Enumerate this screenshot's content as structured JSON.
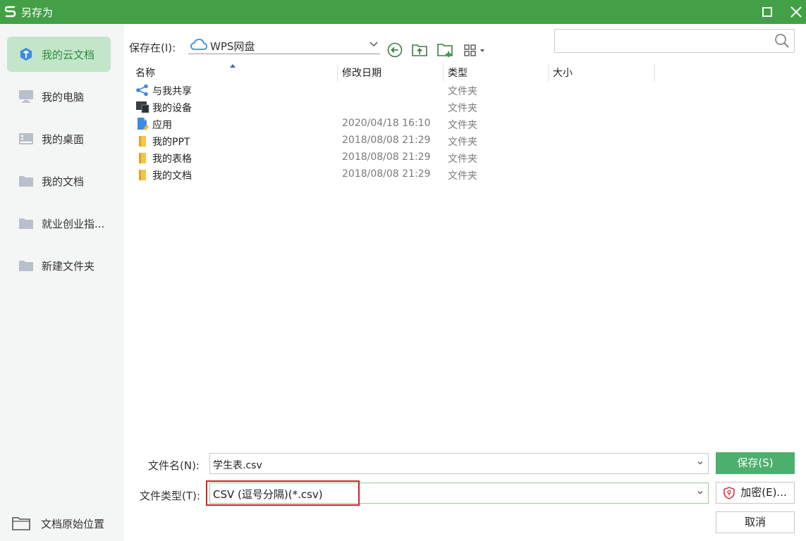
{
  "window": {
    "title": "另存为"
  },
  "sidebar": {
    "items": [
      {
        "label": "我的云文档",
        "icon": "cloud-docs-icon",
        "active": true
      },
      {
        "label": "我的电脑",
        "icon": "computer-icon",
        "active": false
      },
      {
        "label": "我的桌面",
        "icon": "desktop-icon",
        "active": false
      },
      {
        "label": "我的文档",
        "icon": "folder-icon",
        "active": false
      },
      {
        "label": "就业创业指...",
        "icon": "folder-icon",
        "active": false
      },
      {
        "label": "新建文件夹",
        "icon": "folder-icon",
        "active": false
      }
    ],
    "bottom": {
      "label": "文档原始位置",
      "icon": "folder-outline-icon"
    }
  },
  "toolbar": {
    "save_in_label": "保存在(I):",
    "location": "WPS网盘",
    "search_placeholder": ""
  },
  "file_list": {
    "columns": [
      "名称",
      "修改日期",
      "类型",
      "大小"
    ],
    "rows": [
      {
        "name": "与我共享",
        "date": "",
        "type": "文件夹",
        "icon": "share-icon"
      },
      {
        "name": "我的设备",
        "date": "",
        "type": "文件夹",
        "icon": "device-icon"
      },
      {
        "name": "应用",
        "date": "2020/04/18 16:10",
        "type": "文件夹",
        "icon": "app-file-icon"
      },
      {
        "name": "我的PPT",
        "date": "2018/08/08 21:29",
        "type": "文件夹",
        "icon": "folder-icon"
      },
      {
        "name": "我的表格",
        "date": "2018/08/08 21:29",
        "type": "文件夹",
        "icon": "folder-icon"
      },
      {
        "name": "我的文档",
        "date": "2018/08/08 21:29",
        "type": "文件夹",
        "icon": "folder-icon"
      }
    ]
  },
  "form": {
    "filename_label": "文件名(N):",
    "filename_value": "学生表.csv",
    "filetype_label": "文件类型(T):",
    "filetype_value": "CSV (逗号分隔)(*.csv)"
  },
  "buttons": {
    "save": "保存(S)",
    "encrypt": "加密(E)...",
    "cancel": "取消"
  },
  "colors": {
    "accent": "#43a047",
    "sidebar_active": "#c3e6cb",
    "highlight_border": "#d3212c"
  }
}
